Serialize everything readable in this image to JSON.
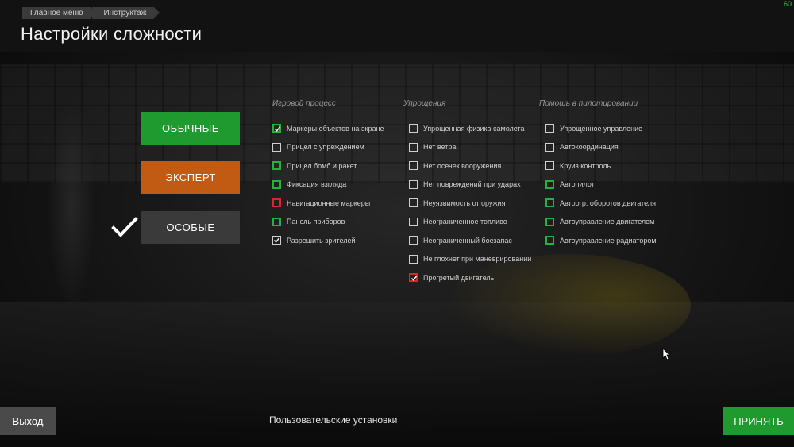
{
  "header": {
    "breadcrumb": [
      "Главное меню",
      "Инструктаж"
    ],
    "title": "Настройки сложности",
    "fps": "60"
  },
  "presets": {
    "normal": "ОБЫЧНЫЕ",
    "expert": "ЭКСПЕРТ",
    "custom": "ОСОБЫЕ",
    "selected": "custom"
  },
  "columns": [
    {
      "title": "Игровой процесс",
      "options": [
        {
          "label": "Маркеры объектов на экране",
          "checked": true,
          "state": "green"
        },
        {
          "label": "Прицел с упреждением",
          "checked": false,
          "state": "none"
        },
        {
          "label": "Прицел бомб и ракет",
          "checked": false,
          "state": "green"
        },
        {
          "label": "Фиксация взгляда",
          "checked": false,
          "state": "green"
        },
        {
          "label": "Навигационные маркеры",
          "checked": false,
          "state": "red"
        },
        {
          "label": "Панель приборов",
          "checked": false,
          "state": "green"
        },
        {
          "label": "Разрешить зрителей",
          "checked": true,
          "state": "none"
        }
      ]
    },
    {
      "title": "Упрощения",
      "options": [
        {
          "label": "Упрощенная физика самолета",
          "checked": false,
          "state": "none"
        },
        {
          "label": "Нет ветра",
          "checked": false,
          "state": "none"
        },
        {
          "label": "Нет осечек вооружения",
          "checked": false,
          "state": "none"
        },
        {
          "label": "Нет повреждений при ударах",
          "checked": false,
          "state": "none"
        },
        {
          "label": "Неуязвимость от оружия",
          "checked": false,
          "state": "none"
        },
        {
          "label": "Неограниченное топливо",
          "checked": false,
          "state": "none"
        },
        {
          "label": "Неограниченный боезапас",
          "checked": false,
          "state": "none"
        },
        {
          "label": "Не глохнет при маневрировании",
          "checked": false,
          "state": "none"
        },
        {
          "label": "Прогретый двигатель",
          "checked": true,
          "state": "red"
        }
      ]
    },
    {
      "title": "Помощь в пилотировании",
      "options": [
        {
          "label": "Упрощенное управление",
          "checked": false,
          "state": "none"
        },
        {
          "label": "Автокоординация",
          "checked": false,
          "state": "none"
        },
        {
          "label": "Круиз контроль",
          "checked": false,
          "state": "none"
        },
        {
          "label": "Автопилот",
          "checked": false,
          "state": "green"
        },
        {
          "label": "Автоогр. оборотов двигателя",
          "checked": false,
          "state": "green"
        },
        {
          "label": "Автоуправление двигателем",
          "checked": false,
          "state": "green"
        },
        {
          "label": "Автоуправление радиатором",
          "checked": false,
          "state": "green"
        }
      ]
    }
  ],
  "footer": {
    "exit_label": "Выход",
    "custom_label": "Пользовательские установки",
    "accept_label": "ПРИНЯТЬ"
  },
  "colors": {
    "green": "#1e9a2e",
    "orange": "#c15a12",
    "gray": "#3a3a3a",
    "outline_green": "#22b33a",
    "outline_red": "#d02a2a"
  }
}
